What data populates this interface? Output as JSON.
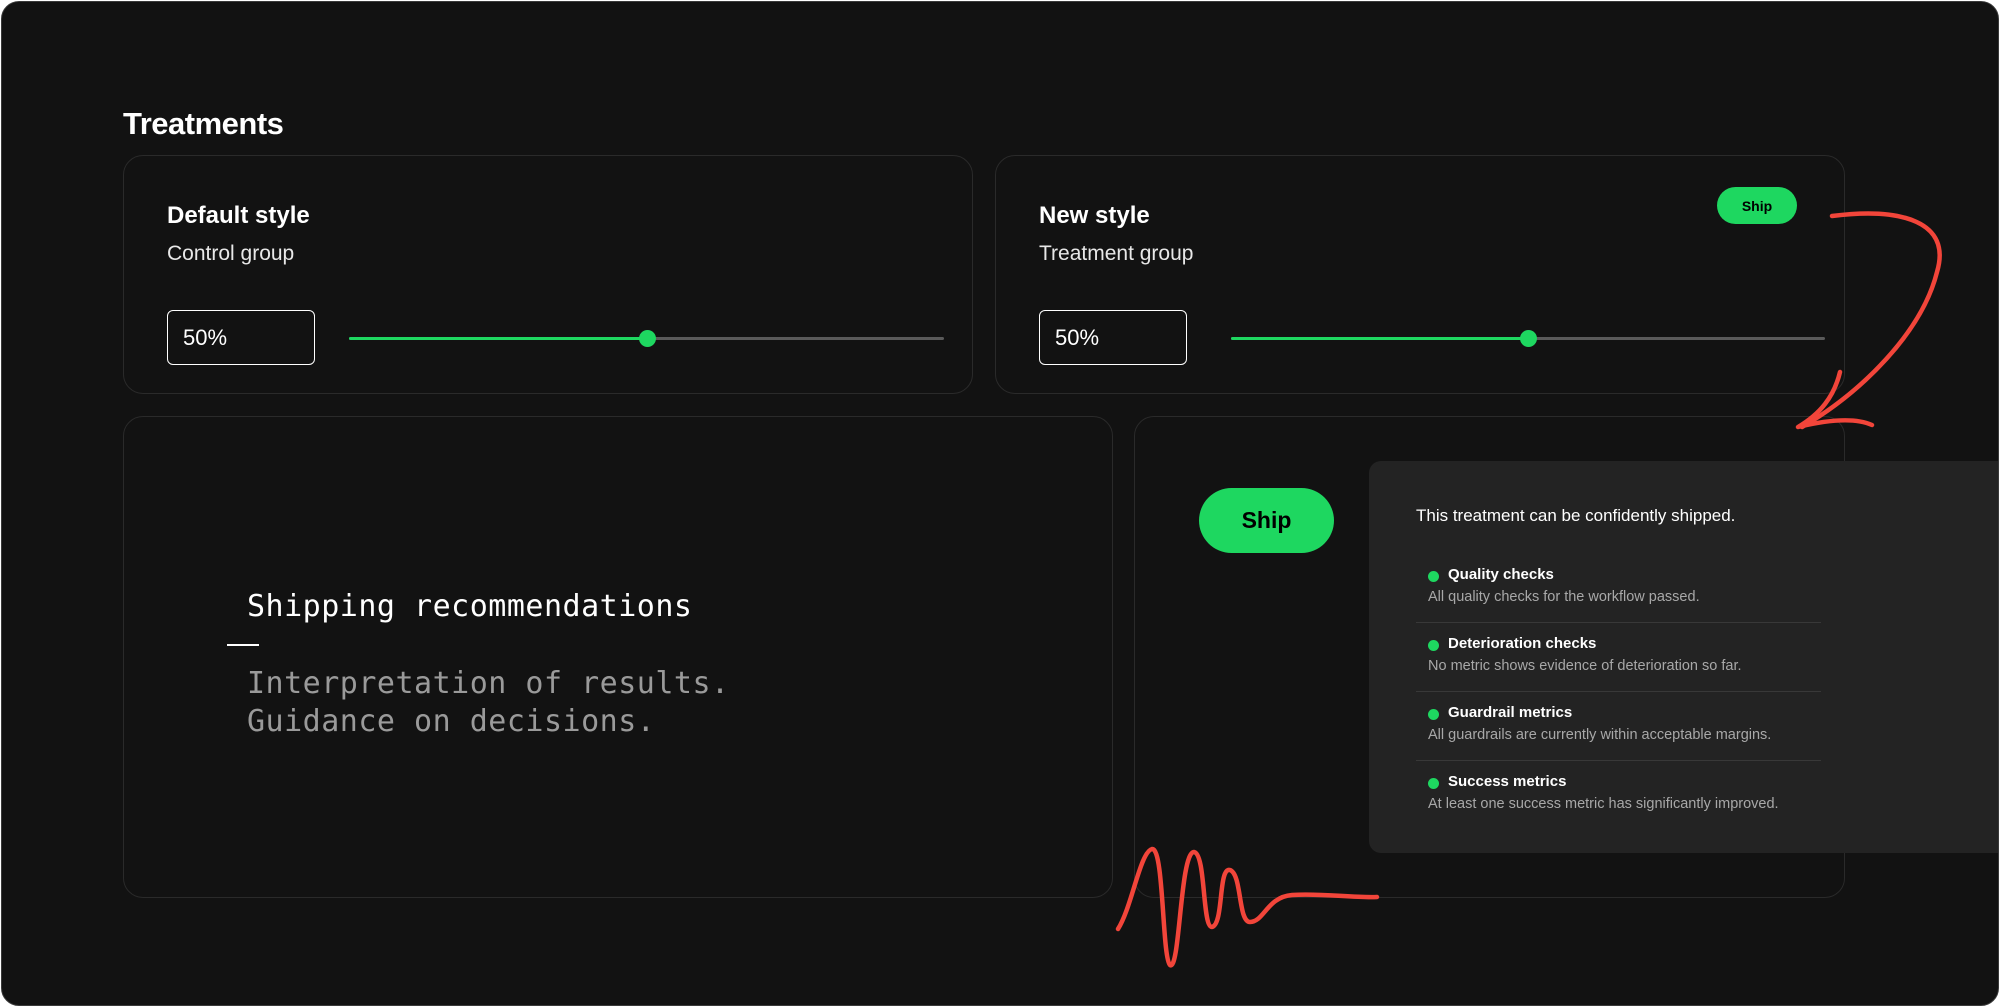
{
  "section": {
    "title": "Treatments"
  },
  "treatments": [
    {
      "title": "Default style",
      "subtitle": "Control group",
      "allocation": "50%",
      "slider_fraction": 0.5
    },
    {
      "title": "New style",
      "subtitle": "Treatment group",
      "allocation": "50%",
      "slider_fraction": 0.5,
      "badge": "Ship"
    }
  ],
  "recommendations": {
    "title": "Shipping recommendations",
    "lines": [
      "Interpretation of results.",
      "Guidance on decisions."
    ]
  },
  "ship_button": {
    "label": "Ship"
  },
  "status_panel": {
    "headline": "This treatment can be confidently shipped.",
    "checks": [
      {
        "name": "Quality checks",
        "description": "All quality checks for the workflow passed."
      },
      {
        "name": "Deterioration checks",
        "description": "No metric shows evidence of deterioration so far."
      },
      {
        "name": "Guardrail metrics",
        "description": "All guardrails are currently within acceptable margins."
      },
      {
        "name": "Success metrics",
        "description": "At least one success metric has significantly improved."
      }
    ]
  },
  "colors": {
    "background": "#121212",
    "accent": "#1ed760",
    "annotation": "#f2453a",
    "panel": "#232323"
  },
  "icons": {
    "status": "green-dot-icon",
    "annotation": "hand-drawn-arrow-icon"
  }
}
